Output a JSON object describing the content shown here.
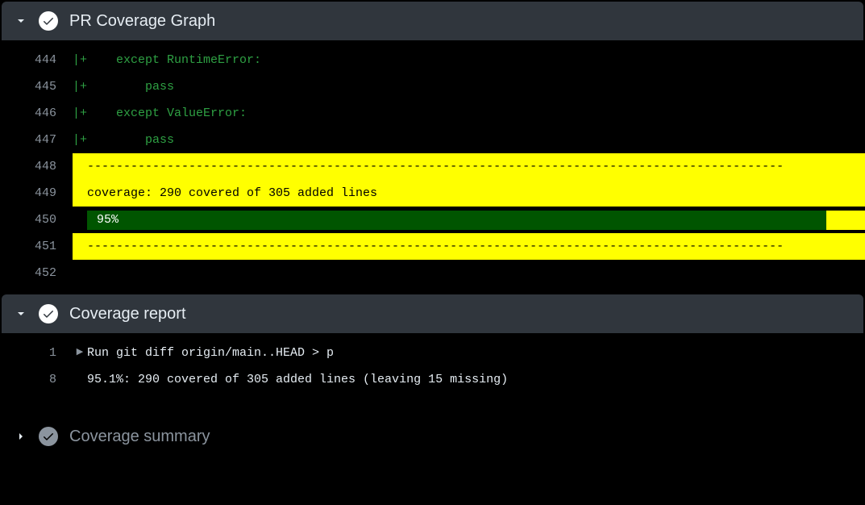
{
  "sections": [
    {
      "id": "pr-coverage-graph",
      "title": "PR Coverage Graph",
      "expanded": true
    },
    {
      "id": "coverage-report",
      "title": "Coverage report",
      "expanded": true
    },
    {
      "id": "coverage-summary",
      "title": "Coverage summary",
      "expanded": false
    }
  ],
  "log1": {
    "lines": [
      {
        "no": "444",
        "gutter": "|+",
        "code": "    except RuntimeError:",
        "style": "green"
      },
      {
        "no": "445",
        "gutter": "|+",
        "code": "        pass",
        "style": "green"
      },
      {
        "no": "446",
        "gutter": "|+",
        "code": "    except ValueError:",
        "style": "green"
      },
      {
        "no": "447",
        "gutter": "|+",
        "code": "        pass",
        "style": "green"
      },
      {
        "no": "448",
        "hl": "yellow",
        "dash": true
      },
      {
        "no": "449",
        "hl": "yellow",
        "code": "coverage: 290 covered of 305 added lines",
        "style": "black"
      },
      {
        "no": "450",
        "bar": true,
        "pct_label": "95%",
        "pct": 95
      },
      {
        "no": "451",
        "hl": "yellow",
        "dash": true
      },
      {
        "no": "452",
        "code": "",
        "style": "white"
      }
    ],
    "dashes": "------------------------------------------------------------------------------------------------",
    "coverage": {
      "covered": 290,
      "added": 305,
      "pct": 95
    }
  },
  "log2": {
    "lines": [
      {
        "no": "1",
        "run": true,
        "text": "Run git diff origin/main..HEAD > p"
      },
      {
        "no": "8",
        "text": "95.1%: 290 covered of 305 added lines (leaving 15 missing)"
      }
    ],
    "coverage": {
      "pct": "95.1%",
      "covered": 290,
      "added": 305,
      "missing": 15
    }
  }
}
